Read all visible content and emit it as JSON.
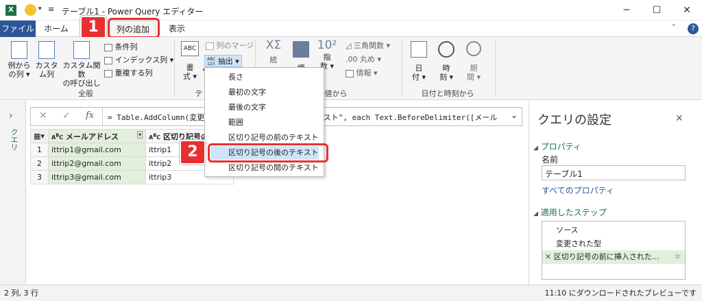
{
  "window": {
    "title": "テーブル1 - Power Query エディター"
  },
  "tabs": {
    "file": "ファイル",
    "home": "ホーム",
    "add_column": "列の追加",
    "view": "表示"
  },
  "ribbon": {
    "general": {
      "label": "全般",
      "from_examples": [
        "例から",
        "の列 ▾"
      ],
      "custom_column": [
        "カスタ",
        "ム列"
      ],
      "invoke_custom_fn": [
        "カスタム関数",
        "の呼び出し"
      ],
      "conditional_column": "条件列",
      "index_column": "インデックス列 ▾",
      "duplicate_column": "重複する列"
    },
    "text": {
      "label_fragment": "テ",
      "format": [
        "書",
        "式 ▾"
      ],
      "merge_columns": "列のマージ",
      "extract": "抽出 ▾",
      "abc123": "ABC\n123"
    },
    "number": {
      "label_fragment": "値から",
      "stats": "統",
      "standard": "標",
      "scientific": [
        "指",
        "数 ▾"
      ],
      "trig": "三角関数 ▾",
      "rounding": "丸め ▾",
      "info": "情報 ▾"
    },
    "datetime": {
      "label": "日付と時刻から",
      "date": [
        "日",
        "付 ▾"
      ],
      "time": [
        "時",
        "刻 ▾"
      ],
      "duration": [
        "期",
        "間 ▾"
      ]
    }
  },
  "left_nav": {
    "label": "クエリ"
  },
  "formula": {
    "text": "= Table.AddColumn(変更された型, \"区切り記号の前のテキスト\", each Text.BeforeDelimiter([メール"
  },
  "grid": {
    "headers": [
      "メールアドレス",
      "区切り記号の..."
    ],
    "rows": [
      {
        "num": "1",
        "email": "ittrip1@gmail.com",
        "before": "ittrip1"
      },
      {
        "num": "2",
        "email": "ittrip2@gmail.com",
        "before": "ittrip2"
      },
      {
        "num": "3",
        "email": "ittrip3@gmail.com",
        "before": "ittrip3"
      }
    ]
  },
  "extract_menu": {
    "items": [
      "長さ",
      "最初の文字",
      "最後の文字",
      "範囲",
      "区切り記号の前のテキスト",
      "区切り記号の後のテキスト",
      "区切り記号の間のテキスト"
    ],
    "highlighted_index": 5
  },
  "query_settings": {
    "title": "クエリの設定",
    "properties_heading": "プロパティ",
    "name_label": "名前",
    "name_value": "テーブル1",
    "all_properties": "すべてのプロパティ",
    "applied_steps_heading": "適用したステップ",
    "steps": [
      "ソース",
      "変更された型",
      "区切り記号の前に挿入された..."
    ]
  },
  "status": {
    "left": "2 列, 3 行",
    "right": "11:10 にダウンロードされたプレビューです"
  },
  "callouts": [
    "1",
    "2"
  ],
  "colors": {
    "accent": "#2b579a",
    "callout": "#e8302f",
    "highlight_col": "#e2efda",
    "link": "#2b579a"
  }
}
